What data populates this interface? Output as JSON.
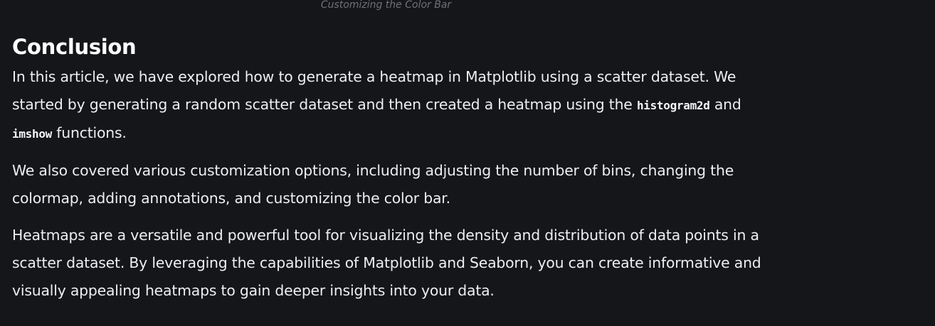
{
  "figure_caption": "Customizing the Color Bar",
  "section": {
    "heading": "Conclusion",
    "paragraph1": {
      "before_code1": "In this article, we have explored how to generate a heatmap in Matplotlib using a scatter dataset. We started by generating a random scatter dataset and then created a heatmap using the ",
      "code1": "histogram2d",
      "between": " and ",
      "code2": "imshow",
      "after_code2": " functions."
    },
    "paragraph2": "We also covered various customization options, including adjusting the number of bins, changing the colormap, adding annotations, and customizing the color bar.",
    "paragraph3": "Heatmaps are a versatile and powerful tool for visualizing the density and distribution of data points in a scatter dataset. By leveraging the capabilities of Matplotlib and Seaborn, you can create informative and visually appealing heatmaps to gain deeper insights into your data."
  }
}
